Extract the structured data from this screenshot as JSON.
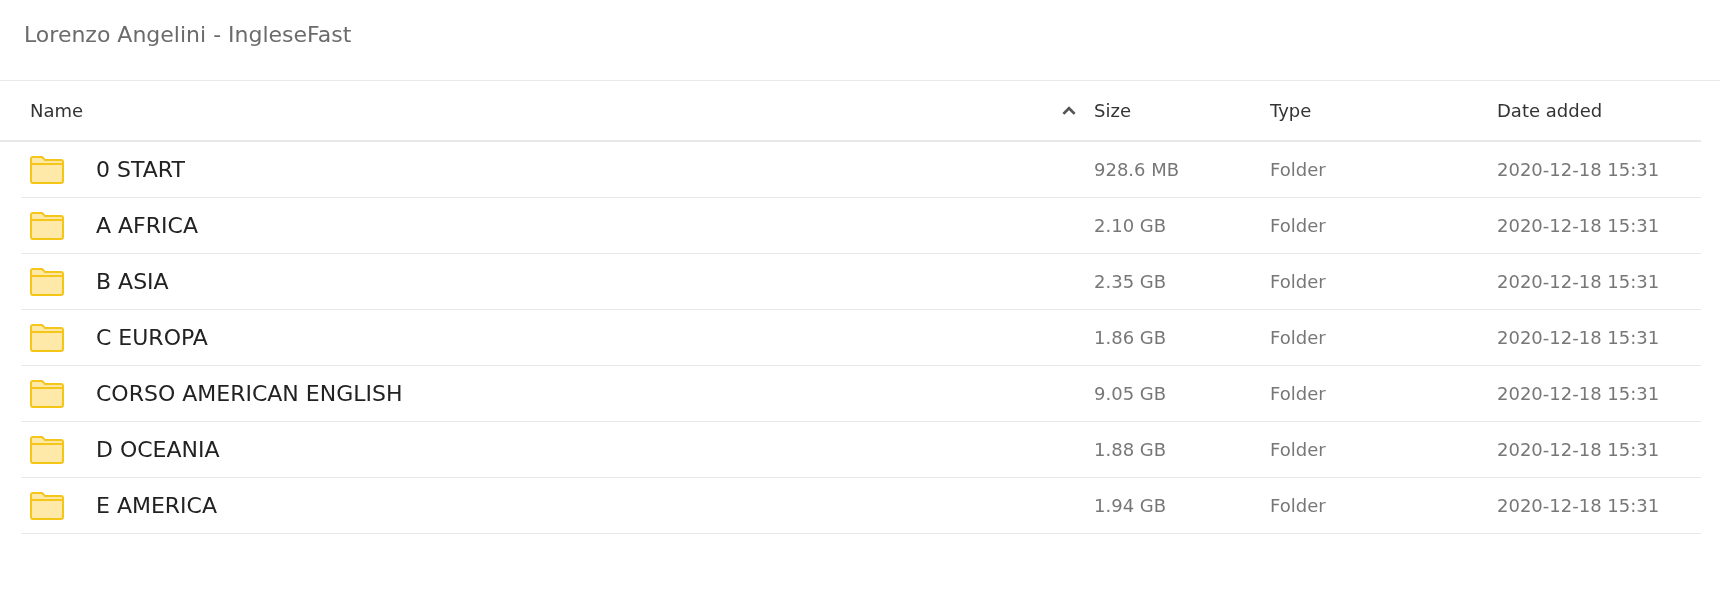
{
  "title": "Lorenzo Angelini - IngleseFast",
  "table": {
    "columns": [
      {
        "label": "Name",
        "sorted": true
      },
      {
        "label": "Size",
        "sorted": false
      },
      {
        "label": "Type",
        "sorted": false
      },
      {
        "label": "Date added",
        "sorted": false
      }
    ],
    "rows": [
      {
        "name": "0 START",
        "size": "928.6 MB",
        "type": "Folder",
        "date": "2020-12-18 15:31"
      },
      {
        "name": "A AFRICA",
        "size": "2.10 GB",
        "type": "Folder",
        "date": "2020-12-18 15:31"
      },
      {
        "name": "B ASIA",
        "size": "2.35 GB",
        "type": "Folder",
        "date": "2020-12-18 15:31"
      },
      {
        "name": "C EUROPA",
        "size": "1.86 GB",
        "type": "Folder",
        "date": "2020-12-18 15:31"
      },
      {
        "name": "CORSO AMERICAN ENGLISH",
        "size": "9.05 GB",
        "type": "Folder",
        "date": "2020-12-18 15:31"
      },
      {
        "name": "D OCEANIA",
        "size": "1.88 GB",
        "type": "Folder",
        "date": "2020-12-18 15:31"
      },
      {
        "name": "E AMERICA",
        "size": "1.94 GB",
        "type": "Folder",
        "date": "2020-12-18 15:31"
      }
    ]
  }
}
